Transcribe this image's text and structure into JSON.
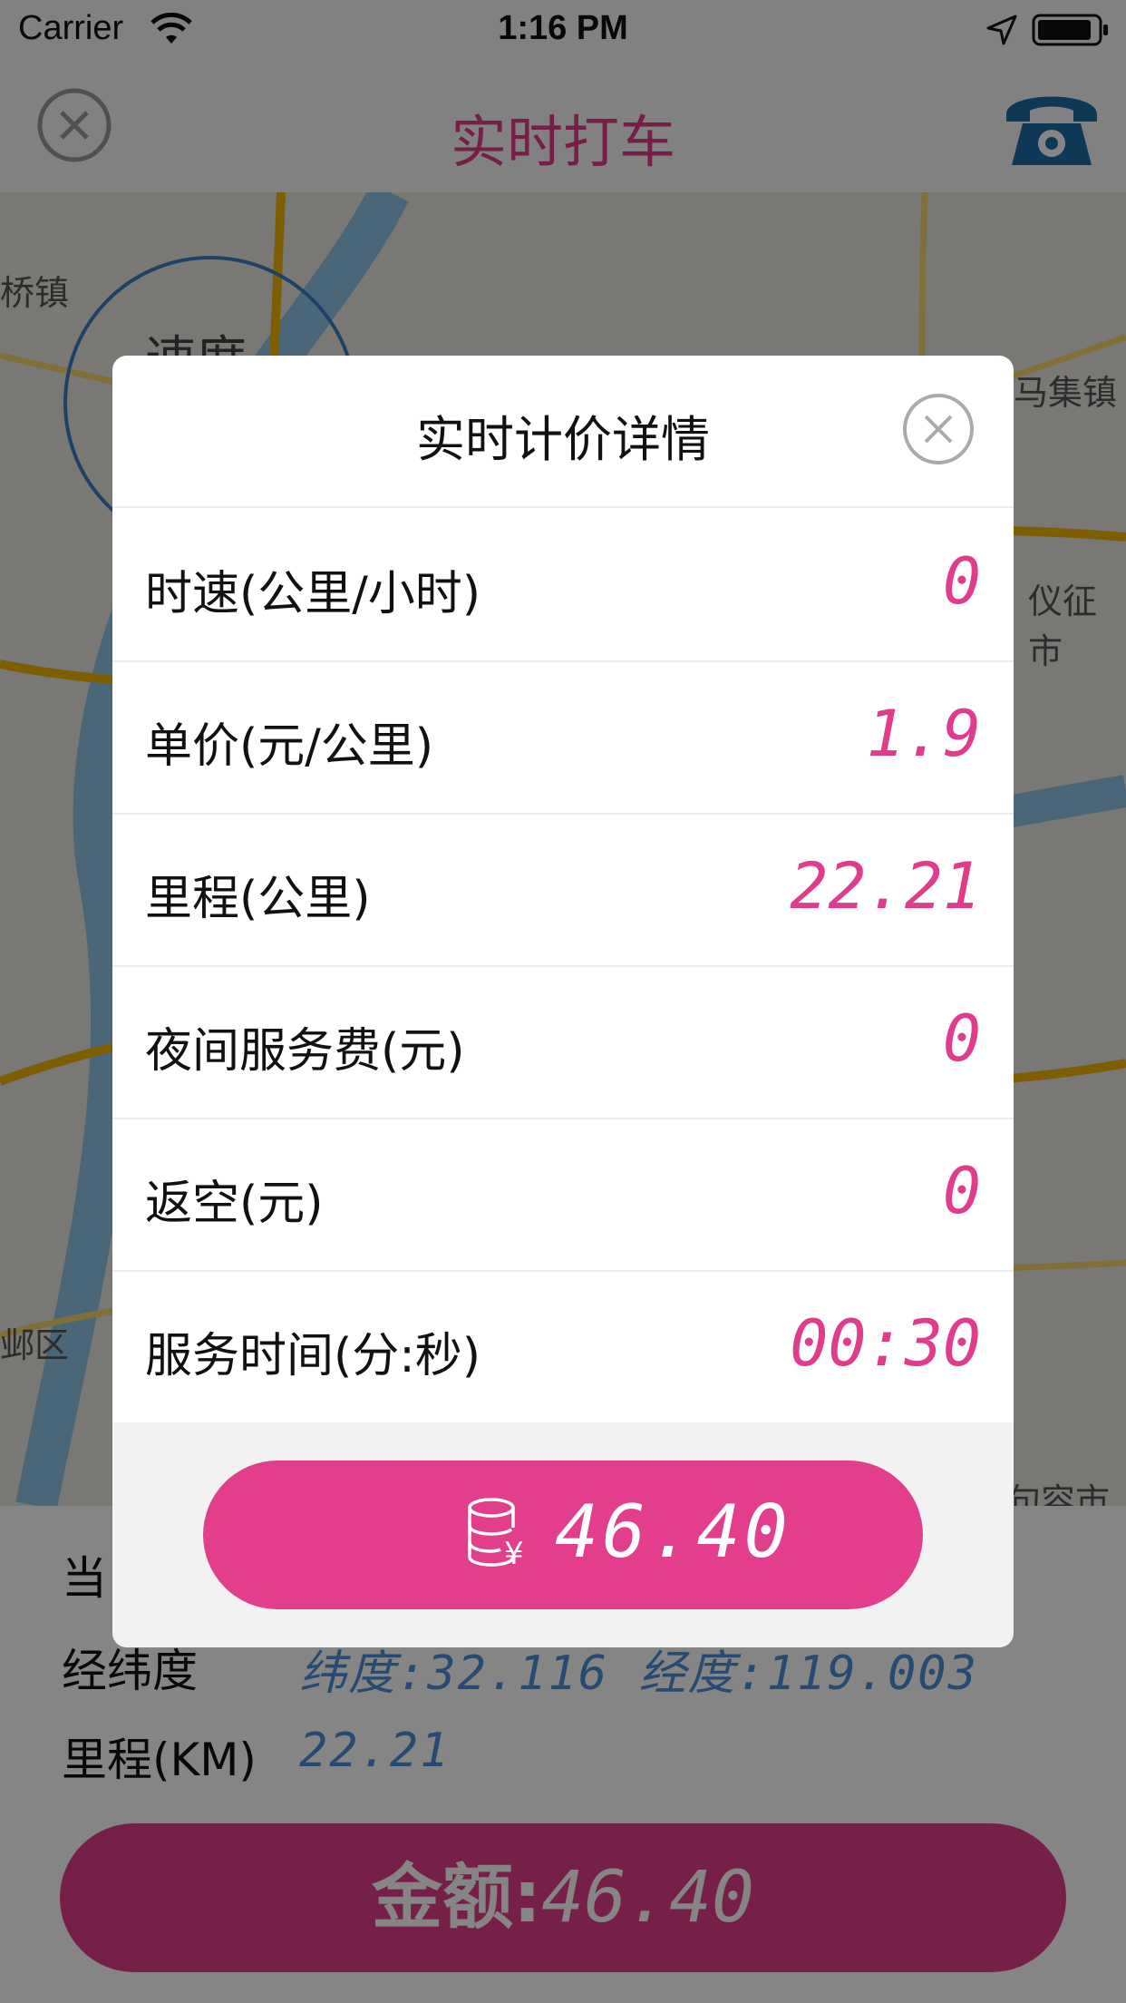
{
  "status_bar": {
    "carrier": "Carrier",
    "time": "1:16 PM"
  },
  "nav": {
    "title": "实时打车"
  },
  "map": {
    "labels": [
      "桥镇",
      "速度",
      "马集镇",
      "仪征市",
      "邺区",
      "句容市"
    ]
  },
  "info_panel": {
    "rows": [
      {
        "label": "当",
        "value": ""
      },
      {
        "label": "经纬度",
        "value": "纬度:32.116  经度:119.003"
      },
      {
        "label": "里程(KM)",
        "value": "22.21"
      }
    ],
    "amount_prefix": "金额:",
    "amount_value": "46.40"
  },
  "modal": {
    "title": "实时计价详情",
    "rows": [
      {
        "label": "时速(公里/小时)",
        "value": "0"
      },
      {
        "label": "单价(元/公里)",
        "value": "1.9"
      },
      {
        "label": "里程(公里)",
        "value": "22.21"
      },
      {
        "label": "夜间服务费(元)",
        "value": "0"
      },
      {
        "label": "返空(元)",
        "value": "0"
      },
      {
        "label": "服务时间(分:秒)",
        "value": "00:30"
      }
    ],
    "total": "46.40"
  },
  "colors": {
    "accent": "#e13b8b",
    "phone": "#1a6ea8",
    "digits_blue": "#4a8fd8"
  },
  "icons": [
    "wifi-icon",
    "location-arrow-icon",
    "battery-icon",
    "close-icon",
    "phone-icon",
    "coin-stack-yen-icon"
  ]
}
